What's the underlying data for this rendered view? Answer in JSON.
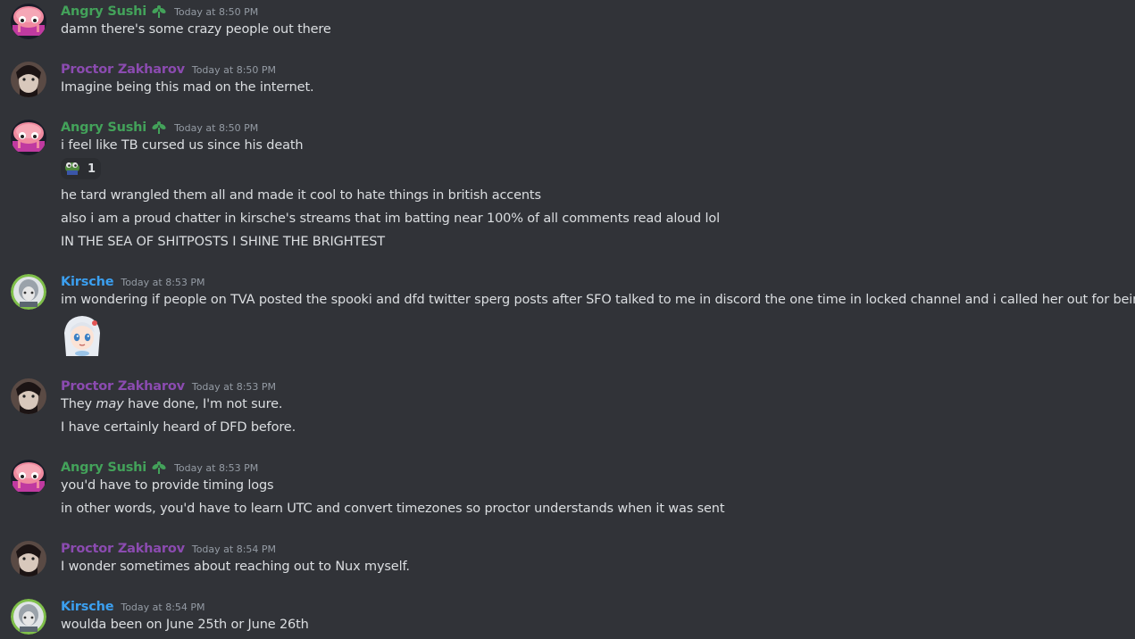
{
  "messages": [
    {
      "author": "Angry Sushi",
      "author_color": "#43a25a",
      "has_badge": true,
      "timestamp": "Today at 8:50 PM",
      "lines": [
        "damn there's some crazy people out there"
      ]
    },
    {
      "author": "Proctor Zakharov",
      "author_color": "#8b4bb0",
      "timestamp": "Today at 8:50 PM",
      "lines": [
        "Imagine being this mad on the internet."
      ]
    },
    {
      "author": "Angry Sushi",
      "author_color": "#43a25a",
      "has_badge": true,
      "timestamp": "Today at 8:50 PM",
      "lines": [
        "i feel like TB cursed us since his death"
      ],
      "reaction": {
        "icon": "pepe-emoji-icon",
        "count": "1"
      },
      "followups": [
        "he tard wrangled them all and made it cool to hate things in british accents",
        "also i am a proud chatter in kirsche's streams that im batting near 100% of all comments read aloud lol",
        "IN THE SEA OF SHITPOSTS I SHINE THE BRIGHTEST"
      ]
    },
    {
      "author": "Kirsche",
      "author_color": "#3b9fef",
      "timestamp": "Today at 8:53 PM",
      "lines": [
        "im wondering if people on TVA posted the spooki and dfd twitter sperg posts after SFO talked to me in discord the one time in locked channel and i called her out for being crazy"
      ],
      "sticker": "anime-girl-sticker"
    },
    {
      "author": "Proctor Zakharov",
      "author_color": "#8b4bb0",
      "timestamp": "Today at 8:53 PM",
      "line_a_pre": "They ",
      "line_a_em": "may",
      "line_a_post": " have done, I'm not sure.",
      "lines": [
        "I have certainly heard of DFD before."
      ]
    },
    {
      "author": "Angry Sushi",
      "author_color": "#43a25a",
      "has_badge": true,
      "timestamp": "Today at 8:53 PM",
      "lines": [
        "you'd have to provide timing logs",
        "in other words, you'd have to learn UTC and convert timezones so proctor understands when it was sent"
      ]
    },
    {
      "author": "Proctor Zakharov",
      "author_color": "#8b4bb0",
      "timestamp": "Today at 8:54 PM",
      "lines": [
        "I wonder sometimes about reaching out to Nux myself."
      ]
    },
    {
      "author": "Kirsche",
      "author_color": "#3b9fef",
      "timestamp": "Today at 8:54 PM",
      "lines": [
        "woulda been on June 25th or June 26th"
      ]
    }
  ],
  "colors": {
    "background": "#313338",
    "text": "#dbdee1",
    "timestamp": "#949ba4"
  }
}
